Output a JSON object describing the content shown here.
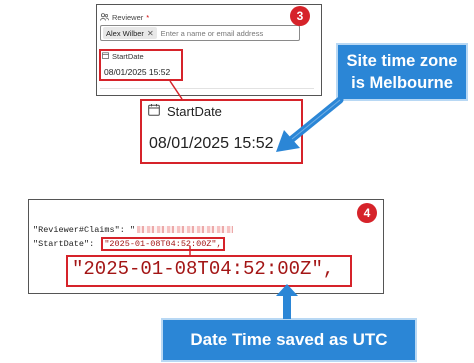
{
  "form": {
    "reviewer_label": "Reviewer",
    "required_mark": "*",
    "reviewer_icon": "people-icon",
    "selected_reviewer": "Alex Wilber",
    "remove_glyph": "✕",
    "reviewer_placeholder": "Enter a name or email address",
    "startdate_label": "StartDate",
    "startdate_icon": "calendar-icon",
    "startdate_value": "08/01/2025 15:52"
  },
  "zoom": {
    "startdate_label": "StartDate",
    "startdate_value": "08/01/2025 15:52"
  },
  "badges": {
    "step_form": "3",
    "step_json": "4"
  },
  "callouts": {
    "timezone_line1": "Site time zone",
    "timezone_line2": "is Melbourne",
    "utc": "Date Time saved as UTC"
  },
  "json": {
    "line1_key": "\"Reviewer#Claims\": \"",
    "line2_key": "\"StartDate\": ",
    "startdate_value": "\"2025-01-08T04:52:00Z\",",
    "zoom_value": "\"2025-01-08T04:52:00Z\","
  },
  "colors": {
    "accent_red": "#d6232a",
    "callout_blue": "#2b86d6",
    "json_string": "#a31515"
  }
}
